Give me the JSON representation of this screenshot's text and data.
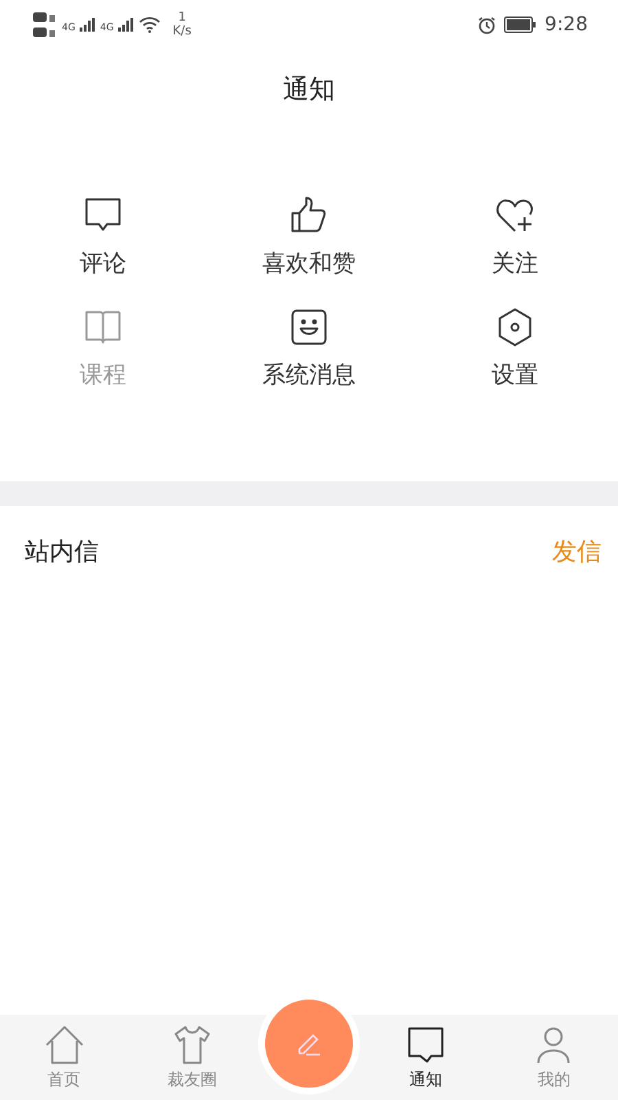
{
  "status_bar": {
    "network_1": "4G",
    "network_2": "4G",
    "speed_value": "1",
    "speed_unit": "K/s",
    "time": "9:28"
  },
  "header": {
    "title": "通知"
  },
  "categories": [
    {
      "label": "评论",
      "disabled": false
    },
    {
      "label": "喜欢和赞",
      "disabled": false
    },
    {
      "label": "关注",
      "disabled": false
    },
    {
      "label": "课程",
      "disabled": true
    },
    {
      "label": "系统消息",
      "disabled": false
    },
    {
      "label": "设置",
      "disabled": false
    }
  ],
  "inbox": {
    "title": "站内信",
    "action": "发信"
  },
  "tab_bar": [
    {
      "label": "首页",
      "selected": false
    },
    {
      "label": "裁友圈",
      "selected": false
    },
    {
      "label": "通知",
      "selected": true
    },
    {
      "label": "我的",
      "selected": false
    }
  ]
}
